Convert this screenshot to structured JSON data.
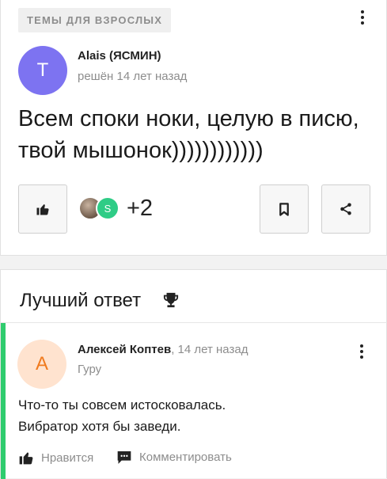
{
  "question": {
    "category": "ТЕМЫ ДЛЯ ВЗРОСЛЫХ",
    "author": {
      "initial": "T",
      "name": "Alais (ЯСМИН)",
      "avatar_color": "#7d73f1"
    },
    "status": "решён 14 лет назад",
    "text": "Всем споки ноки, целую в писю, твой мышонок))))))))))))",
    "actions": {
      "like_icon": "thumbs-up-icon",
      "bookmark_icon": "bookmark-icon",
      "share_icon": "share-icon"
    },
    "followers": {
      "avatars": [
        {
          "type": "photo"
        },
        {
          "initial": "S",
          "color": "#2fcc86"
        }
      ],
      "extra_count": "+2"
    }
  },
  "best_answer": {
    "title": "Лучший ответ",
    "title_icon": "trophy-icon",
    "accent_color": "#2fcc6e",
    "author": {
      "initial": "А",
      "name": "Алексей Коптев",
      "avatar_color": "#ffe3cf",
      "initial_color": "#f07b1f"
    },
    "time": "14 лет назад",
    "time_separator": ",",
    "rank": "Гуру",
    "text_lines": [
      "Что-то ты совсем истосковалась.",
      "Вибратор хотя бы заведи."
    ],
    "like_label": "Нравится",
    "comment_label": "Комментировать"
  }
}
